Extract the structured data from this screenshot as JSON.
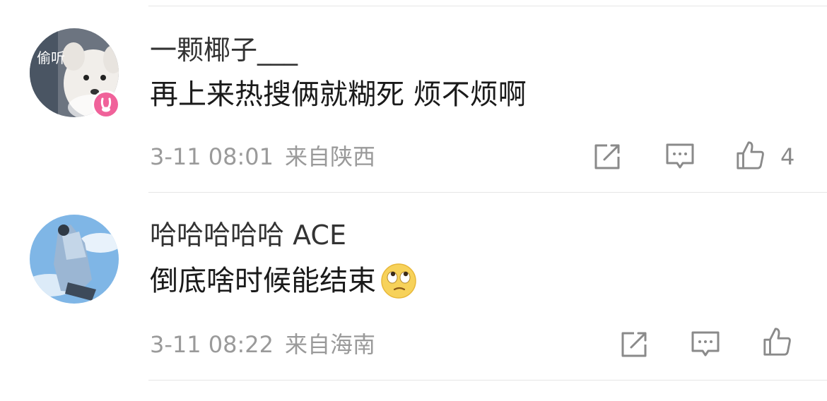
{
  "comments": [
    {
      "avatar_label": "偷听",
      "username": "一颗椰子___",
      "text": "再上来热搜俩就糊死 烦不烦啊",
      "timestamp": "3-11 08:01",
      "location": "来自陕西",
      "likes": "4",
      "vip": true,
      "icons": {
        "share": "share-icon",
        "reply": "comment-icon",
        "like": "thumbs-up-icon"
      }
    },
    {
      "username": "哈哈哈哈哈 ACE",
      "text": "倒底啥时候能结束",
      "emoji": "eye-roll-emoji",
      "timestamp": "3-11 08:22",
      "location": "来自海南",
      "likes": "",
      "vip": false,
      "icons": {
        "share": "share-icon",
        "reply": "comment-icon",
        "like": "thumbs-up-icon"
      }
    }
  ],
  "colors": {
    "vip_badge": "#f0629a",
    "meta_text": "#9a9a9a",
    "icon_stroke": "#8a8a8a",
    "divider": "#e6e6e6"
  }
}
